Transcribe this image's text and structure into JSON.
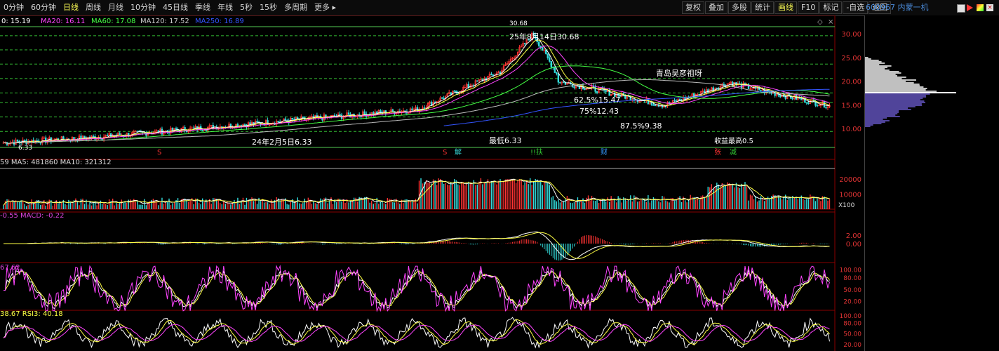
{
  "toolbar": {
    "tabs": [
      "0分钟",
      "60分钟",
      "日线",
      "周线",
      "月线",
      "10分钟",
      "45日线",
      "季线",
      "年线",
      "5秒",
      "15秒",
      "多周期",
      "更多"
    ],
    "active_tab": "日线",
    "tools": [
      "复权",
      "叠加",
      "多股",
      "统计",
      "画线",
      "F10",
      "标记",
      "-自选",
      "返回"
    ],
    "active_tool": "画线",
    "stock": "600967 内蒙一机"
  },
  "main_panel": {
    "ma_legend": [
      {
        "text": "0: 15.19",
        "color": "#ffffff"
      },
      {
        "text": "MA20: 16.11",
        "color": "#ff44ff"
      },
      {
        "text": "MA60: 17.08",
        "color": "#44ff44"
      },
      {
        "text": "MA120: 17.52",
        "color": "#cccccc"
      },
      {
        "text": "MA250: 16.89",
        "color": "#3355ff"
      }
    ],
    "y_ticks": [
      "30.00",
      "25.00",
      "20.00",
      "15.00",
      "10.00"
    ],
    "annotations": {
      "high_label": "25年8月14日30.68",
      "high_small": "30.68",
      "low_label": "24年2月5日6.33",
      "low_small": "6.33",
      "lowest": "最低6.33",
      "yield_high": "收益最高0.5",
      "note": "青岛吴彦祖呀",
      "fib1": "62.5%15.47",
      "fib2": "75%12.43",
      "fib3": "87.5%9.38"
    },
    "markers": [
      {
        "text": "S",
        "color": "#ff3333"
      },
      {
        "text": "S",
        "color": "#ff3333"
      },
      {
        "text": "解",
        "color": "#33cccc"
      },
      {
        "text": "!!扶",
        "color": "#33cc33"
      },
      {
        "text": "财",
        "color": "#3399ff"
      },
      {
        "text": "张",
        "color": "#ff3333"
      },
      {
        "text": "减",
        "color": "#33cc33"
      }
    ]
  },
  "vol_panel": {
    "legend": "59  MA5: 481860  MA10: 321312",
    "y_ticks": [
      "20000",
      "10000"
    ],
    "unit": "X100"
  },
  "macd_panel": {
    "legend": "-0.55  MACD: -0.22",
    "y_ticks": [
      "2.00",
      "0.00"
    ]
  },
  "kdj_panel": {
    "legend": "67.62",
    "y_ticks": [
      "100.00",
      "80.00",
      "50.00",
      "20.00"
    ]
  },
  "rsi_panel": {
    "legend": "38.67  RSI3: 40.18",
    "y_ticks": [
      "100.00",
      "80.00",
      "50.00",
      "20.00"
    ]
  },
  "colors": {
    "up": "#ff3333",
    "down": "#33cccc",
    "grid": "#990000",
    "gridline": "#00aa00"
  }
}
